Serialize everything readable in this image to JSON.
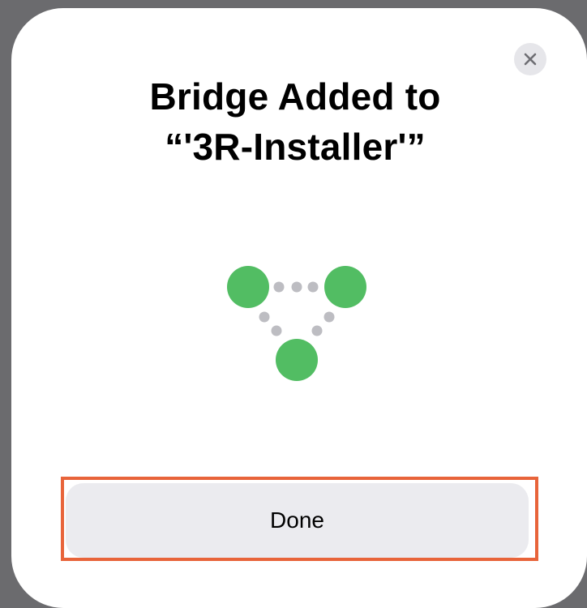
{
  "dialog": {
    "title_line1": "Bridge Added to",
    "title_line2": "“'3R-Installer'”",
    "close_icon": "close-icon",
    "illustration_icon": "bridge-network-icon",
    "done_label": "Done"
  },
  "colors": {
    "backdrop": "#6b6b6e",
    "card": "#ffffff",
    "node_green": "#52bd63",
    "link_dots": "#bdbdc2",
    "button_bg": "#ebebef",
    "highlight": "#e8643a"
  }
}
